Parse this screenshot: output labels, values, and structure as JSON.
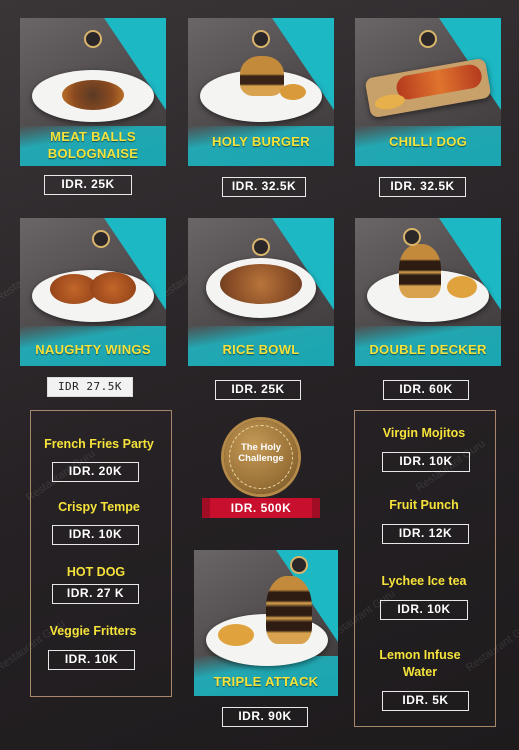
{
  "watermark": "Restaurant Guru",
  "cards": [
    {
      "label": "MEAT BALLS BOLOGNAISE",
      "price": "IDR. 25K"
    },
    {
      "label": "HOLY BURGER",
      "price": "IDR. 32.5K"
    },
    {
      "label": "CHILLI DOG",
      "price": "IDR. 32.5K"
    },
    {
      "label": "NAUGHTY WINGS",
      "price": "IDR 27.5K"
    },
    {
      "label": "RICE BOWL",
      "price": "IDR. 25K"
    },
    {
      "label": "DOUBLE DECKER",
      "price": "IDR. 60K"
    },
    {
      "label": "TRIPLE ATTACK",
      "price": "IDR. 90K"
    }
  ],
  "challenge": {
    "line1": "The Holy",
    "line2": "Challenge",
    "price": "IDR. 500K"
  },
  "left_items": [
    {
      "name": "French Fries Party",
      "price": "IDR. 20K"
    },
    {
      "name": "Crispy Tempe",
      "price": "IDR. 10K"
    },
    {
      "name": "HOT DOG",
      "price": "IDR. 27 K"
    },
    {
      "name": "Veggie Fritters",
      "price": "IDR. 10K"
    }
  ],
  "right_items": [
    {
      "name": "Virgin Mojitos",
      "price": "IDR. 10K"
    },
    {
      "name": "Fruit Punch",
      "price": "IDR. 12K"
    },
    {
      "name": "Lychee Ice tea",
      "price": "IDR. 10K"
    },
    {
      "name": "Lemon Infuse Water",
      "price": "IDR. 5K"
    }
  ],
  "colors": {
    "accent": "#1cb8c4",
    "label": "#f5e23a",
    "ribbon": "#c8102e",
    "frame": "#a8876a"
  },
  "icons": [
    "restaurant-logo-icon"
  ]
}
